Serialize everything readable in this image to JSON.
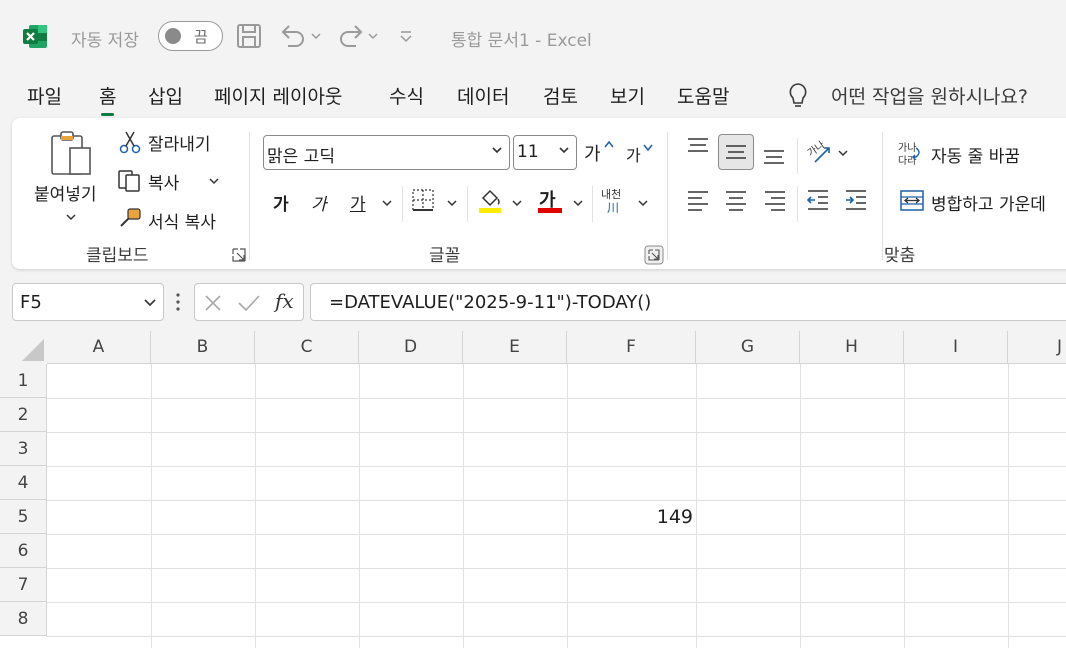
{
  "titlebar": {
    "autosave_label": "자동 저장",
    "toggle_state": "끔",
    "doc_title": "통합 문서1  -  Excel"
  },
  "menu": {
    "items": [
      "파일",
      "홈",
      "삽입",
      "페이지 레이아웃",
      "수식",
      "데이터",
      "검토",
      "보기",
      "도움말"
    ],
    "active": "홈",
    "tell_me": "어떤 작업을 원하시나요?"
  },
  "ribbon": {
    "clipboard": {
      "paste": "붙여넣기",
      "cut": "잘라내기",
      "copy": "복사",
      "format_painter": "서식 복사",
      "label": "클립보드"
    },
    "font": {
      "font_name": "맑은 고딕",
      "font_size": "11",
      "grow": "가",
      "shrink": "가",
      "bold": "가",
      "italic": "가",
      "underline": "가",
      "font_color_letter": "가",
      "phonetic_top": "내천",
      "phonetic_bottom": "川",
      "label": "글꼴",
      "fill_color": "#ffeb00",
      "font_color": "#e00000"
    },
    "alignment": {
      "wrap_text": "자동 줄 바꿈",
      "merge_center": "병합하고 가운데",
      "wrap_icon_text": "가나 다라",
      "label": "맞춤"
    }
  },
  "formula_bar": {
    "name_box": "F5",
    "fx": "fx",
    "formula": "=DATEVALUE(\"2025-9-11\")-TODAY()"
  },
  "sheet": {
    "columns": [
      "A",
      "B",
      "C",
      "D",
      "E",
      "F",
      "G",
      "H",
      "I",
      "J"
    ],
    "rows": [
      "1",
      "2",
      "3",
      "4",
      "5",
      "6",
      "7",
      "8"
    ],
    "cells": {
      "F5": "149"
    }
  }
}
